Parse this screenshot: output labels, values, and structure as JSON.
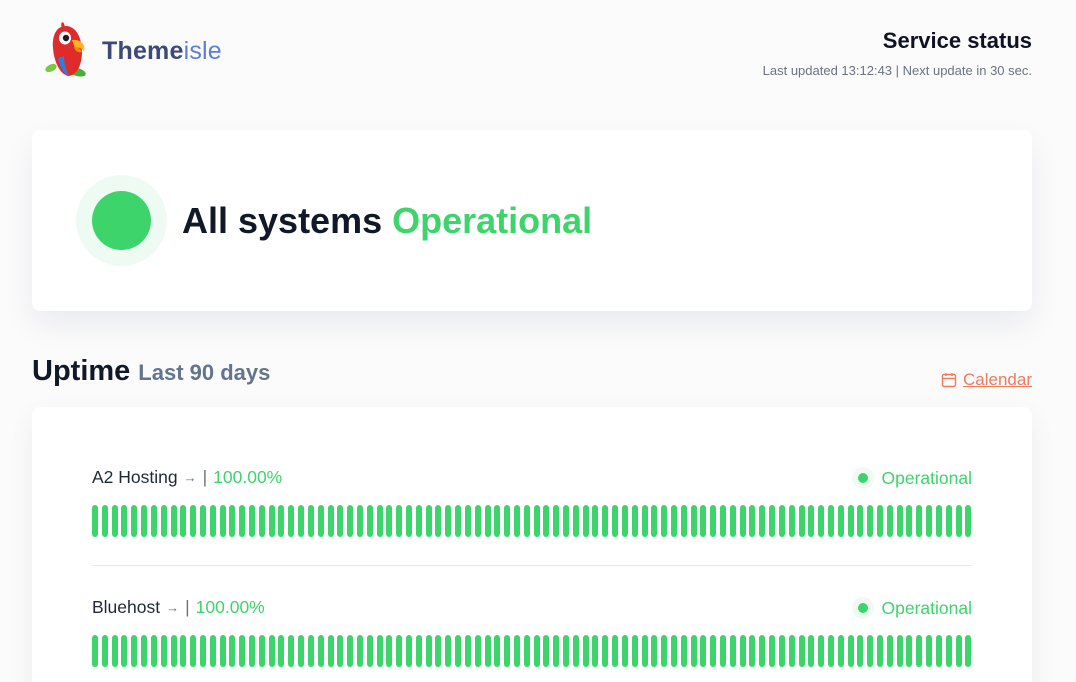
{
  "header": {
    "brand_main": "Theme",
    "brand_accent": "isle",
    "title": "Service status",
    "subtitle": "Last updated 13:12:43 | Next update in 30 sec."
  },
  "hero": {
    "text_prefix": "All systems",
    "text_status": "Operational",
    "status_color": "#3dd46b"
  },
  "uptime": {
    "title": "Uptime",
    "range": "Last 90 days",
    "calendar_label": "Calendar",
    "calendar_icon": "calendar-icon",
    "services": [
      {
        "name": "A2 Hosting",
        "arrow": "→",
        "separator": "|",
        "uptime": "100.00%",
        "status": "Operational",
        "day_count": 90
      },
      {
        "name": "Bluehost",
        "arrow": "→",
        "separator": "|",
        "uptime": "100.00%",
        "status": "Operational",
        "day_count": 90
      }
    ]
  },
  "colors": {
    "operational": "#3dd46b",
    "accent_link": "#ef7b5c",
    "brand_dark": "#3c4a75",
    "brand_light": "#5b7fd6"
  }
}
